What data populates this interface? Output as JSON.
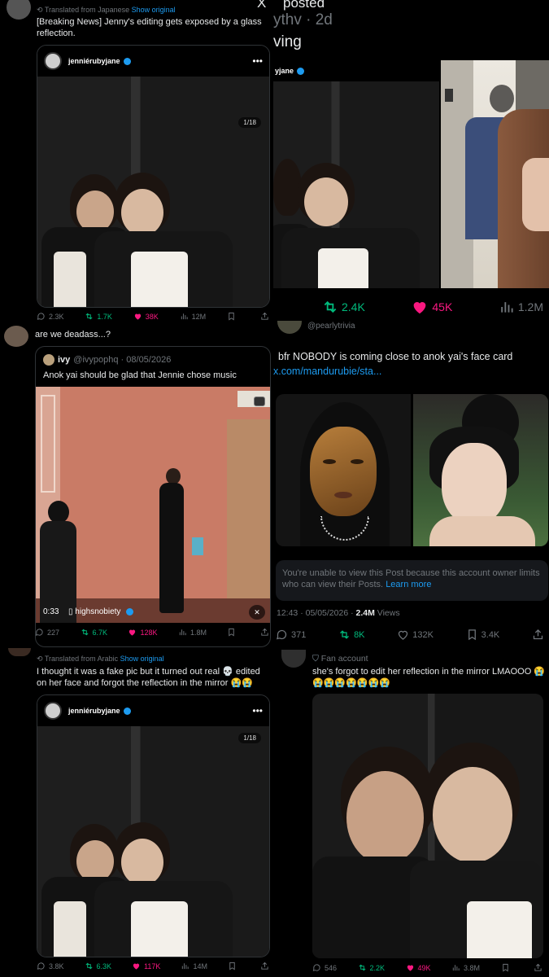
{
  "panels": {
    "top_left": {
      "translated_from": "Translated from Japanese",
      "show_original": "Show original",
      "text": "[Breaking News] Jenny's editing gets exposed by a glass reflection.",
      "embed": {
        "username": "jenniérubyjane",
        "counter": "1/18"
      },
      "actions": {
        "replies": "2.3K",
        "reposts": "1.7K",
        "likes": "38K",
        "views": "12M"
      }
    },
    "top_right": {
      "header_x": "X",
      "header_reposted": "posted",
      "handle_time": "ythv · 2d",
      "text_fragment": "ving",
      "embed_username": "yjane",
      "actions": {
        "reposts": "2.4K",
        "likes": "45K",
        "views": "1.2M"
      }
    },
    "mid_left": {
      "text": "are we deadass...?",
      "quote": {
        "name": "ivy",
        "handle_date": "@ivypophq · 08/05/2026",
        "text": "Anok yai should be glad that Jennie chose music"
      },
      "video": {
        "time": "0:33",
        "source": "highsnobiety"
      },
      "actions": {
        "replies": "227",
        "reposts": "6.7K",
        "likes": "128K",
        "views": "1.8M"
      }
    },
    "mid_right": {
      "handle": "@pearlytrivia",
      "text": "bfr NOBODY is coming close to anok yai's face card",
      "link": "x.com/mandurubie/sta...",
      "restricted_text": "You're unable to view this Post because this account owner limits who can view their Posts.",
      "learn_more": "Learn more",
      "meta_time": "12:43 · 05/05/2026 · ",
      "meta_views": "2.4M",
      "meta_views_label": " Views",
      "actions": {
        "replies": "371",
        "reposts": "8K",
        "likes": "132K",
        "bookmarks": "3.4K"
      }
    },
    "bottom_left": {
      "translated_from": "Translated from Arabic",
      "show_original": "Show original",
      "text": "I thought it was a fake pic but it turned out real 💀 edited on her face and forgot the reflection in the mirror 😭😭",
      "embed": {
        "username": "jenniérubyjane",
        "counter": "1/18"
      },
      "actions": {
        "replies": "3.8K",
        "reposts": "6.3K",
        "likes": "117K",
        "views": "14M"
      }
    },
    "bottom_right": {
      "label": "Fan account",
      "text": "she's forgot to edit her reflection in the mirror LMAOOO 😭😭😭😭😭😭😭😭",
      "actions": {
        "replies": "546",
        "reposts": "2.2K",
        "likes": "49K",
        "views": "3.8M"
      }
    }
  },
  "colors": {
    "accent": "#1d9bf0",
    "like": "#f91880",
    "repost": "#00ba7c",
    "muted": "#71767b"
  },
  "icons": [
    "reply-icon",
    "repost-icon",
    "heart-icon",
    "views-icon",
    "bookmark-icon",
    "share-icon",
    "more-icon",
    "verified-icon",
    "mute-icon",
    "x-logo-icon"
  ]
}
